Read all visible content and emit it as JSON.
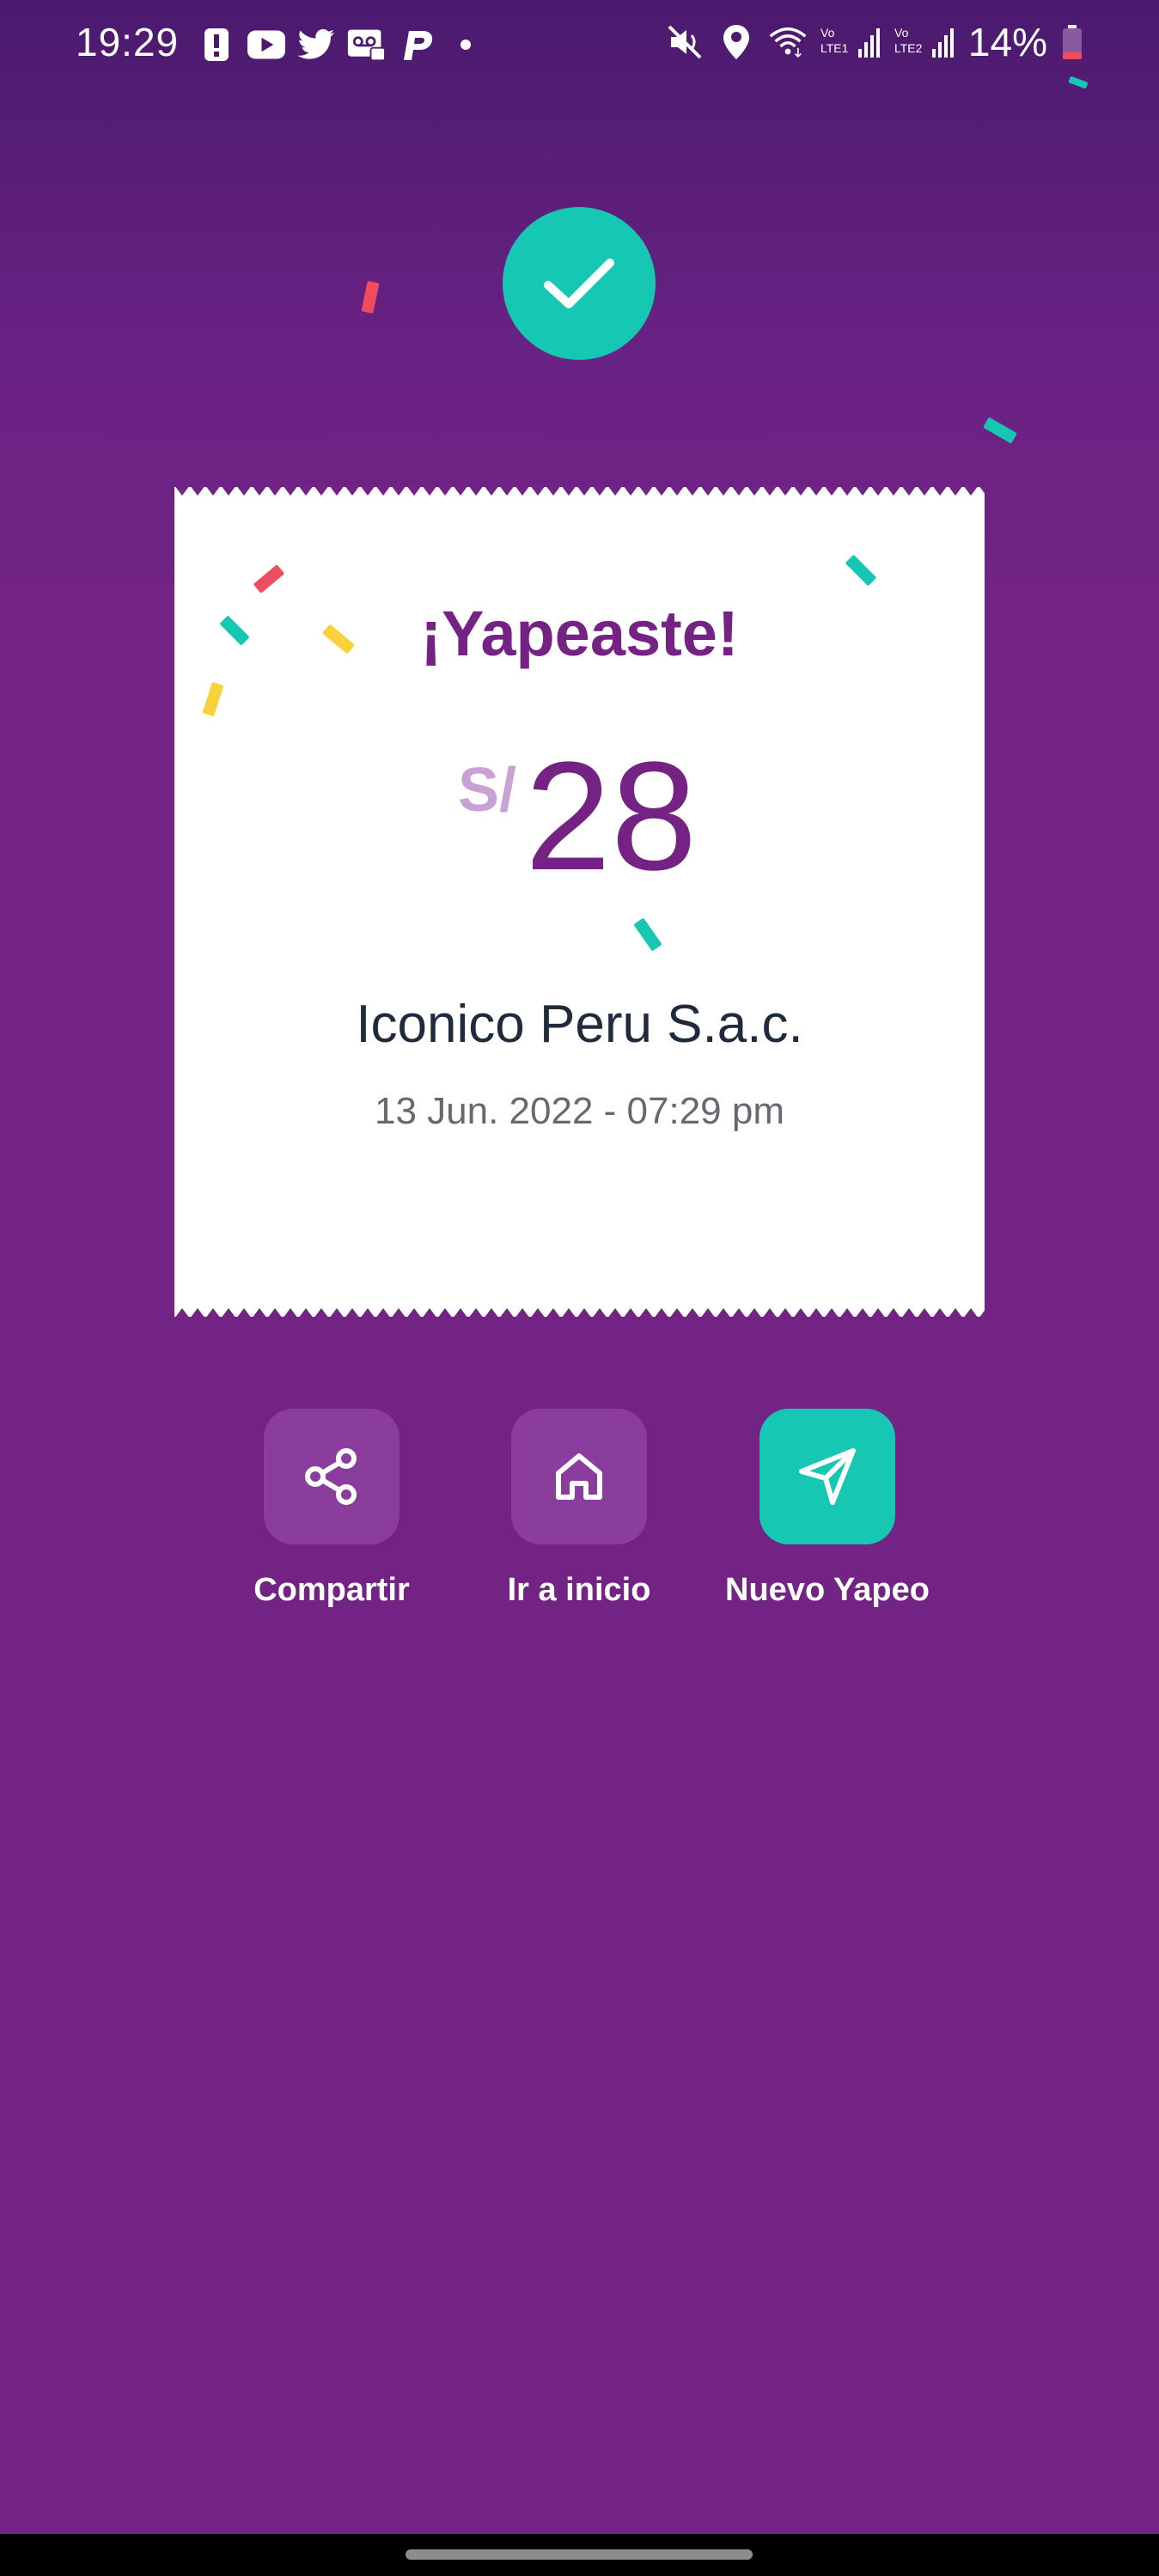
{
  "status_bar": {
    "time": "19:29",
    "battery": "14%",
    "left_icons": [
      "alert-icon",
      "youtube-icon",
      "twitter-icon",
      "voicemail-icon",
      "parking-icon",
      "dot-icon"
    ],
    "right_icons": [
      "mute-icon",
      "location-icon",
      "wifi-icon",
      "signal-lte1-icon",
      "signal-lte2-icon",
      "battery-icon"
    ]
  },
  "success_icon": "check-icon",
  "receipt": {
    "title": "¡Yapeaste!",
    "currency": "S/",
    "amount": "28",
    "merchant": "Iconico Peru S.a.c.",
    "datetime": "13 Jun. 2022 - 07:29 pm"
  },
  "actions": [
    {
      "label": "Compartir",
      "icon": "share-icon"
    },
    {
      "label": "Ir a inicio",
      "icon": "home-icon"
    },
    {
      "label": "Nuevo Yapeo",
      "icon": "send-icon"
    }
  ],
  "colors": {
    "brand_purple": "#742284",
    "accent_teal": "#16c7b3",
    "confetti_red": "#ef4d5e",
    "confetti_yellow": "#f9d23a"
  }
}
